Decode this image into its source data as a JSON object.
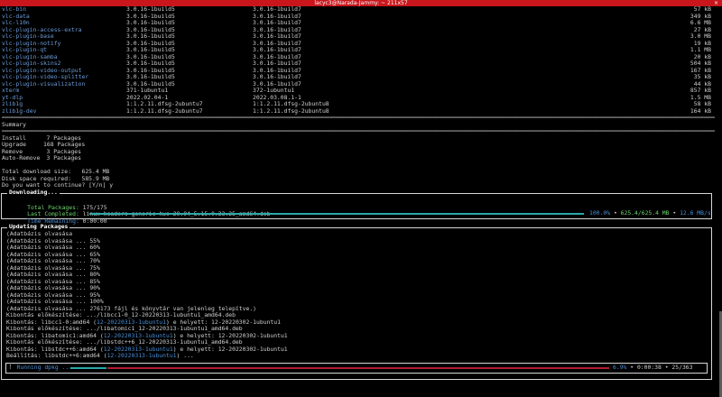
{
  "window": {
    "title": "lacyc3@Narada-Jammy: ~ 211x57",
    "close_glyph": "×"
  },
  "packages": [
    {
      "name": "vlc-bin",
      "old": "3.0.16-1build5",
      "new": "3.0.16-1build7",
      "size": "57 kB"
    },
    {
      "name": "vlc-data",
      "old": "3.0.16-1build5",
      "new": "3.0.16-1build7",
      "size": "349 kB"
    },
    {
      "name": "vlc-l10n",
      "old": "3.0.16-1build5",
      "new": "3.0.16-1build7",
      "size": "6.6 MB"
    },
    {
      "name": "vlc-plugin-access-extra",
      "old": "3.0.16-1build5",
      "new": "3.0.16-1build7",
      "size": "27 kB"
    },
    {
      "name": "vlc-plugin-base",
      "old": "3.0.16-1build5",
      "new": "3.0.16-1build7",
      "size": "3.0 MB"
    },
    {
      "name": "vlc-plugin-notify",
      "old": "3.0.16-1build5",
      "new": "3.0.16-1build7",
      "size": "19 kB"
    },
    {
      "name": "vlc-plugin-qt",
      "old": "3.0.16-1build5",
      "new": "3.0.16-1build7",
      "size": "1.1 MB"
    },
    {
      "name": "vlc-plugin-samba",
      "old": "3.0.16-1build5",
      "new": "3.0.16-1build7",
      "size": "20 kB"
    },
    {
      "name": "vlc-plugin-skins2",
      "old": "3.0.16-1build5",
      "new": "3.0.16-1build7",
      "size": "504 kB"
    },
    {
      "name": "vlc-plugin-video-output",
      "old": "3.0.16-1build5",
      "new": "3.0.16-1build7",
      "size": "167 kB"
    },
    {
      "name": "vlc-plugin-video-splitter",
      "old": "3.0.16-1build5",
      "new": "3.0.16-1build7",
      "size": "35 kB"
    },
    {
      "name": "vlc-plugin-visualization",
      "old": "3.0.16-1build5",
      "new": "3.0.16-1build7",
      "size": "44 kB"
    },
    {
      "name": "xterm",
      "old": "371-1ubuntu1",
      "new": "372-1ubuntu1",
      "size": "857 kB"
    },
    {
      "name": "yt-dlp",
      "old": "2022.02.04-1",
      "new": "2022.03.08.1-1",
      "size": "1.5 MB"
    },
    {
      "name": "zlib1g",
      "old": "1:1.2.11.dfsg-2ubuntu7",
      "new": "1:1.2.11.dfsg-2ubuntu8",
      "size": "58 kB"
    },
    {
      "name": "zlib1g-dev",
      "old": "1:1.2.11.dfsg-2ubuntu7",
      "new": "1:1.2.11.dfsg-2ubuntu8",
      "size": "164 kB"
    }
  ],
  "summary": {
    "heading": "Summary",
    "rows": [
      {
        "label": "Install",
        "count": "7 Packages"
      },
      {
        "label": "Upgrade",
        "count": "168 Packages"
      },
      {
        "label": "Remove",
        "count": "3 Packages"
      },
      {
        "label": "Auto-Remove",
        "count": "3 Packages"
      }
    ],
    "download_size": "Total download size:   625.4 MB",
    "disk_space": "Disk space required:   585.9 MB",
    "prompt": "Do you want to continue? [Y/n] y"
  },
  "downloading": {
    "title": "Downloading...",
    "total_label": "Total Packages:",
    "total_value": "175/175",
    "last_label": "Last Completed:",
    "last_value": "linux-headers-generic-hwe-20.04_5.15.0.23.25_amd64.deb",
    "time_label": "Time Remaining:",
    "time_value": "0:00:00",
    "percent": "100.0%",
    "size": "625.4/625.4 MB",
    "speed": "12.6 MB/s",
    "progress": 1.0
  },
  "updating": {
    "title": "Updating Packages",
    "lines": [
      "(Adatbázis olvasása",
      "(Adatbázis olvasása ... 55%",
      "(Adatbázis olvasása ... 60%",
      "(Adatbázis olvasása ... 65%",
      "(Adatbázis olvasása ... 70%",
      "(Adatbázis olvasása ... 75%",
      "(Adatbázis olvasása ... 80%",
      "(Adatbázis olvasása ... 85%",
      "(Adatbázis olvasása ... 90%",
      "(Adatbázis olvasása ... 95%",
      "(Adatbázis olvasása ... 100%",
      "(Adatbázis olvasása ... 276173 fájl és könyvtár van jelenleg telepítve.)",
      "Kibontás előkészítése: .../libcc1-0_12-20220313-1ubuntu1_amd64.deb"
    ],
    "rich_lines": [
      {
        "a": "Kibontás: libcc1-0:amd64 (",
        "b": "12-20220313-1ubuntu1",
        "c": ") e helyett: 12-20220302-1ubuntu1"
      },
      {
        "a": "Kibontás előkészítése: .../libatomic1_12-20220313-1ubuntu1_amd64.deb",
        "b": "",
        "c": ""
      },
      {
        "a": "Kibontás: libatomic1:amd64 (",
        "b": "12-20220313-1ubuntu1",
        "c": ") e helyett: 12-20220302-1ubuntu1"
      },
      {
        "a": "Kibontás előkészítése: .../libstdc++6_12-20220313-1ubuntu1_amd64.deb",
        "b": "",
        "c": ""
      },
      {
        "a": "Kibontás: libstdc++6:amd64 (",
        "b": "12-20220313-1ubuntu1",
        "c": ") e helyett: 12-20220302-1ubuntu1"
      },
      {
        "a": "Beállítás: libstdc++6:amd64 (",
        "b": "12-20220313-1ubuntu1",
        "c": ") ..."
      }
    ],
    "running_label": "Running dpkg ...",
    "percent": "6.9%",
    "elapsed": "0:00:38",
    "count": "25/363",
    "progress": 0.069
  },
  "colors": {
    "title_bar": "#c8161c",
    "package_name": "#6c9bd8",
    "accent_cyan": "#2aa8a8",
    "error_red": "#b31b2e"
  }
}
